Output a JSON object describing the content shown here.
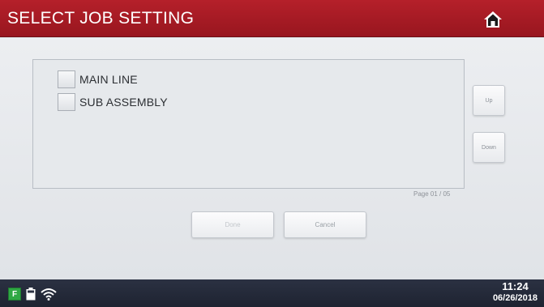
{
  "header": {
    "title": "SELECT JOB SETTING",
    "home_icon": "home-icon"
  },
  "list": {
    "items": [
      {
        "label": "MAIN LINE",
        "checked": false
      },
      {
        "label": "SUB ASSEMBLY",
        "checked": false
      }
    ]
  },
  "pager": {
    "up_label": "Up",
    "down_label": "Down",
    "page_indicator": "Page 01 / 05"
  },
  "actions": {
    "done_label": "Done",
    "done_enabled": false,
    "cancel_label": "Cancel"
  },
  "status_bar": {
    "icons": [
      "app-icon",
      "battery-icon",
      "wifi-icon"
    ],
    "app_icon_glyph": "F",
    "time": "11:24",
    "date": "06/26/2018"
  },
  "colors": {
    "header": "#a81b24",
    "status_bar": "#252a3a",
    "app_icon": "#2fa844"
  }
}
